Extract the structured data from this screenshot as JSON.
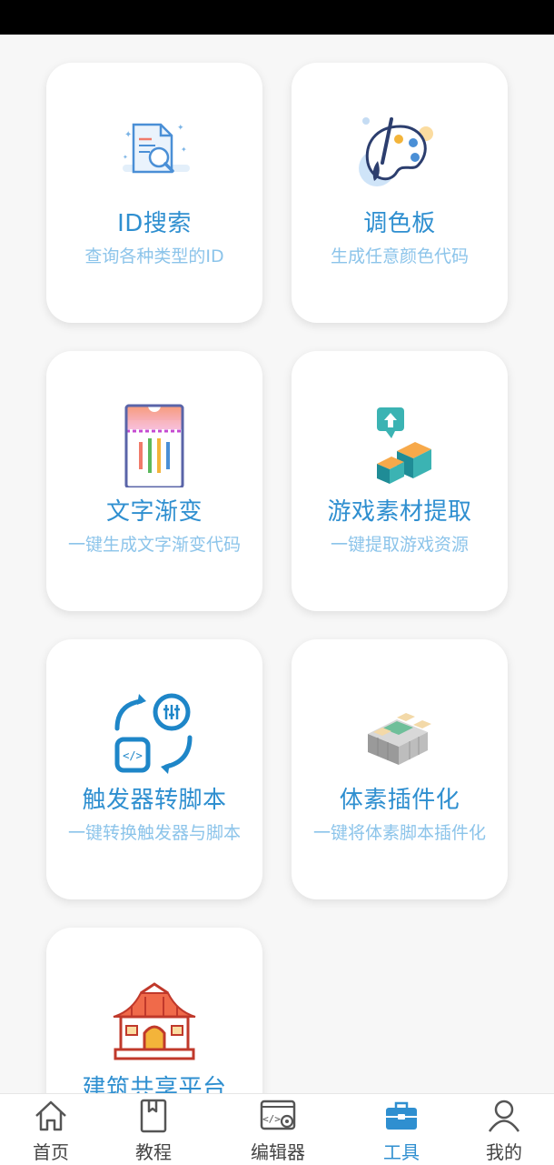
{
  "tools": [
    {
      "title": "ID搜索",
      "subtitle": "查询各种类型的ID"
    },
    {
      "title": "调色板",
      "subtitle": "生成任意颜色代码"
    },
    {
      "title": "文字渐变",
      "subtitle": "一键生成文字渐变代码"
    },
    {
      "title": "游戏素材提取",
      "subtitle": "一键提取游戏资源"
    },
    {
      "title": "触发器转脚本",
      "subtitle": "一键转换触发器与脚本"
    },
    {
      "title": "体素插件化",
      "subtitle": "一键将体素脚本插件化"
    },
    {
      "title": "建筑共享平台",
      "subtitle": ""
    }
  ],
  "tabbar": {
    "items": [
      {
        "label": "首页",
        "icon": "home-icon"
      },
      {
        "label": "教程",
        "icon": "book-icon"
      },
      {
        "label": "编辑器",
        "icon": "code-editor-icon"
      },
      {
        "label": "工具",
        "icon": "toolbox-icon",
        "active": true
      },
      {
        "label": "我的",
        "icon": "user-icon"
      }
    ]
  },
  "colors": {
    "accent": "#2f8fd0",
    "subtitle": "#8cc4ea",
    "background": "#f7f7f7"
  }
}
